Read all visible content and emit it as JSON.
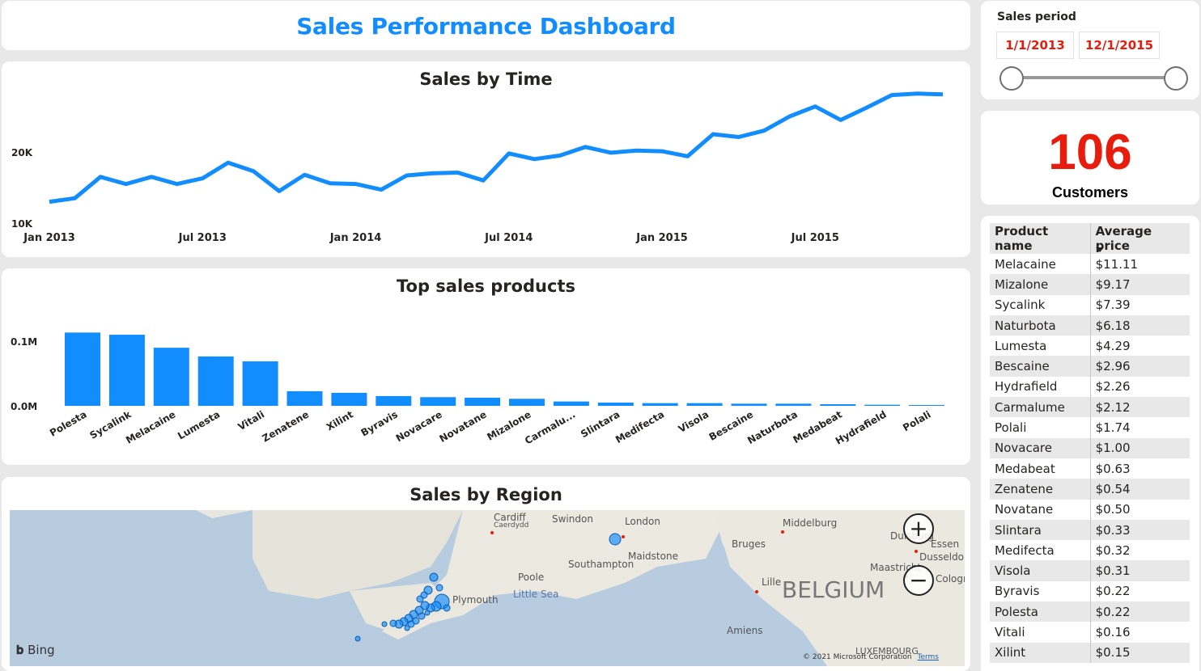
{
  "header": {
    "title": "Sales Performance Dashboard"
  },
  "time_chart": {
    "title": "Sales by Time"
  },
  "products_chart": {
    "title": "Top sales products"
  },
  "region_map": {
    "title": "Sales by Region",
    "labels": [
      "Cardiff",
      "Caerdydd",
      "Swindon",
      "London",
      "Southampton",
      "Maidstone",
      "Poole",
      "Little Sea",
      "Plymouth",
      "Bruges",
      "Middelburg",
      "Duisburg",
      "Essen",
      "Dusseldorf",
      "Lille",
      "BELGIUM",
      "Maastricht",
      "Amiens",
      "LUXEMBOURG",
      "Cologne"
    ],
    "bing": "Bing",
    "copyright": "© 2021 Microsoft Corporation",
    "terms": "Terms",
    "zoom_in": "+",
    "zoom_out": "−"
  },
  "period": {
    "label": "Sales period",
    "start": "1/1/2013",
    "end": "12/1/2015"
  },
  "kpi": {
    "value": "106",
    "label": "Customers"
  },
  "product_table": {
    "headers": [
      "Product name",
      "Average price"
    ],
    "rows": [
      [
        "Melacaine",
        "$11.11"
      ],
      [
        "Mizalone",
        "$9.17"
      ],
      [
        "Sycalink",
        "$7.39"
      ],
      [
        "Naturbota",
        "$6.18"
      ],
      [
        "Lumesta",
        "$4.29"
      ],
      [
        "Bescaine",
        "$2.96"
      ],
      [
        "Hydrafield",
        "$2.26"
      ],
      [
        "Carmalume",
        "$2.12"
      ],
      [
        "Polali",
        "$1.74"
      ],
      [
        "Novacare",
        "$1.00"
      ],
      [
        "Medabeat",
        "$0.63"
      ],
      [
        "Zenatene",
        "$0.54"
      ],
      [
        "Novatane",
        "$0.50"
      ],
      [
        "Slintara",
        "$0.33"
      ],
      [
        "Medifecta",
        "$0.32"
      ],
      [
        "Visola",
        "$0.31"
      ],
      [
        "Byravis",
        "$0.22"
      ],
      [
        "Polesta",
        "$0.22"
      ],
      [
        "Vitali",
        "$0.16"
      ],
      [
        "Xilint",
        "$0.15"
      ]
    ]
  },
  "colors": {
    "accent": "#118dff",
    "kpi": "#e81c0d"
  },
  "chart_data": [
    {
      "type": "line",
      "title": "Sales by Time",
      "x": [
        "Jan 2013",
        "Feb 2013",
        "Mar 2013",
        "Apr 2013",
        "May 2013",
        "Jun 2013",
        "Jul 2013",
        "Aug 2013",
        "Sep 2013",
        "Oct 2013",
        "Nov 2013",
        "Dec 2013",
        "Jan 2014",
        "Feb 2014",
        "Mar 2014",
        "Apr 2014",
        "May 2014",
        "Jun 2014",
        "Jul 2014",
        "Aug 2014",
        "Sep 2014",
        "Oct 2014",
        "Nov 2014",
        "Dec 2014",
        "Jan 2015",
        "Feb 2015",
        "Mar 2015",
        "Apr 2015",
        "May 2015",
        "Jun 2015",
        "Jul 2015",
        "Aug 2015",
        "Sep 2015",
        "Oct 2015",
        "Nov 2015",
        "Dec 2015"
      ],
      "x_ticks": [
        "Jan 2013",
        "Jul 2013",
        "Jan 2014",
        "Jul 2014",
        "Jan 2015",
        "Jul 2015"
      ],
      "y_ticks": [
        "10K",
        "20K"
      ],
      "values": [
        13000,
        13500,
        16500,
        15500,
        16500,
        15500,
        16300,
        18500,
        17300,
        14500,
        16800,
        15600,
        15500,
        14700,
        16700,
        17000,
        17100,
        16000,
        19800,
        19000,
        19500,
        20700,
        19900,
        20200,
        20100,
        19400,
        22500,
        22100,
        23000,
        25000,
        26400,
        24500,
        26200,
        28000,
        28200,
        28100
      ],
      "ylim": [
        10000,
        30000
      ],
      "series": [
        {
          "color": "#118dff"
        }
      ]
    },
    {
      "type": "bar",
      "title": "Top sales products",
      "categories": [
        "Polesta",
        "Sycalink",
        "Melacaine",
        "Lumesta",
        "Vitali",
        "Zenatene",
        "Xilint",
        "Byravis",
        "Novacare",
        "Novatane",
        "Mizalone",
        "Carmalu...",
        "Slintara",
        "Medifecta",
        "Visola",
        "Bescaine",
        "Naturbota",
        "Medabeat",
        "Hydrafield",
        "Polali"
      ],
      "values": [
        0.135,
        0.131,
        0.107,
        0.091,
        0.082,
        0.027,
        0.024,
        0.018,
        0.016,
        0.015,
        0.013,
        0.008,
        0.006,
        0.005,
        0.005,
        0.004,
        0.004,
        0.003,
        0.002,
        0.001
      ],
      "y_ticks": [
        "0.0M",
        "0.1M"
      ],
      "ylim": [
        0,
        0.14
      ],
      "series": [
        {
          "color": "#118dff"
        }
      ]
    }
  ]
}
